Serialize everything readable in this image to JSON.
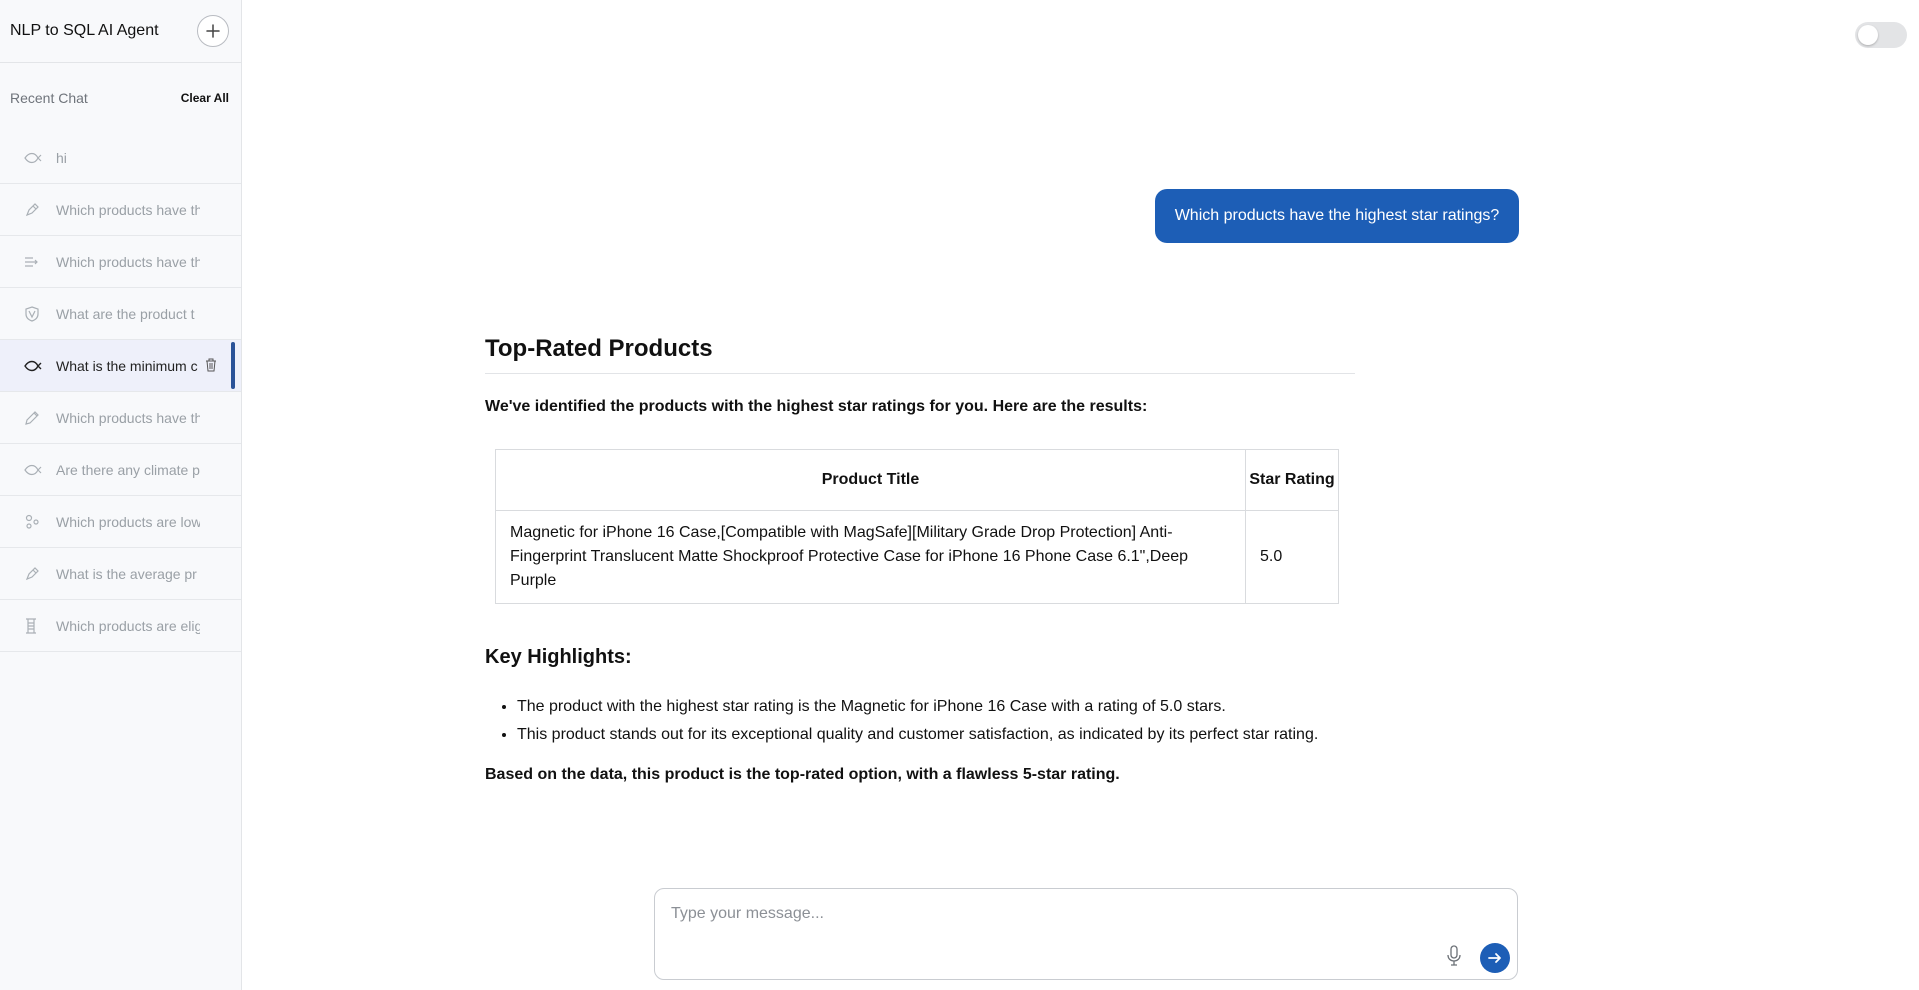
{
  "app": {
    "title": "NLP to SQL AI Agent"
  },
  "sidebar": {
    "recent_label": "Recent Chat",
    "clear_all_label": "Clear All",
    "items": [
      {
        "label": "hi",
        "icon": "fish-icon"
      },
      {
        "label": "Which products have th",
        "icon": "pen-icon"
      },
      {
        "label": "Which products have th",
        "icon": "lines-arrow-icon"
      },
      {
        "label": "What are the product t",
        "icon": "shield-icon"
      },
      {
        "label": "What is the minimum c",
        "icon": "fish-icon",
        "active": true
      },
      {
        "label": "Which products have th",
        "icon": "pencil-icon"
      },
      {
        "label": "Are there any climate p",
        "icon": "fish-icon"
      },
      {
        "label": "Which products are low",
        "icon": "molecule-icon"
      },
      {
        "label": "What is the average pr",
        "icon": "pen-icon"
      },
      {
        "label": "Which products are elig",
        "icon": "spool-icon"
      }
    ]
  },
  "chat": {
    "user_message": "Which products have the highest star ratings?",
    "response": {
      "title": "Top-Rated Products",
      "intro": "We've identified the products with the highest star ratings for you. Here are the results:",
      "table": {
        "headers": [
          "Product Title",
          "Star Rating"
        ],
        "rows": [
          [
            "Magnetic for iPhone 16 Case,[Compatible with MagSafe][Military Grade Drop Protection] Anti-Fingerprint Translucent Matte Shockproof Protective Case for iPhone 16 Phone Case 6.1\",Deep Purple",
            "5.0"
          ]
        ]
      },
      "highlights_title": "Key Highlights:",
      "highlights": [
        "The product with the highest star rating is the Magnetic for iPhone 16 Case with a rating of 5.0 stars.",
        "This product stands out for its exceptional quality and customer satisfaction, as indicated by its perfect star rating."
      ],
      "conclusion": "Based on the data, this product is the top-rated option, with a flawless 5-star rating."
    }
  },
  "composer": {
    "placeholder": "Type your message..."
  },
  "theme": {
    "accent": "#1d5eb6",
    "active_bar": "#2a5298"
  }
}
